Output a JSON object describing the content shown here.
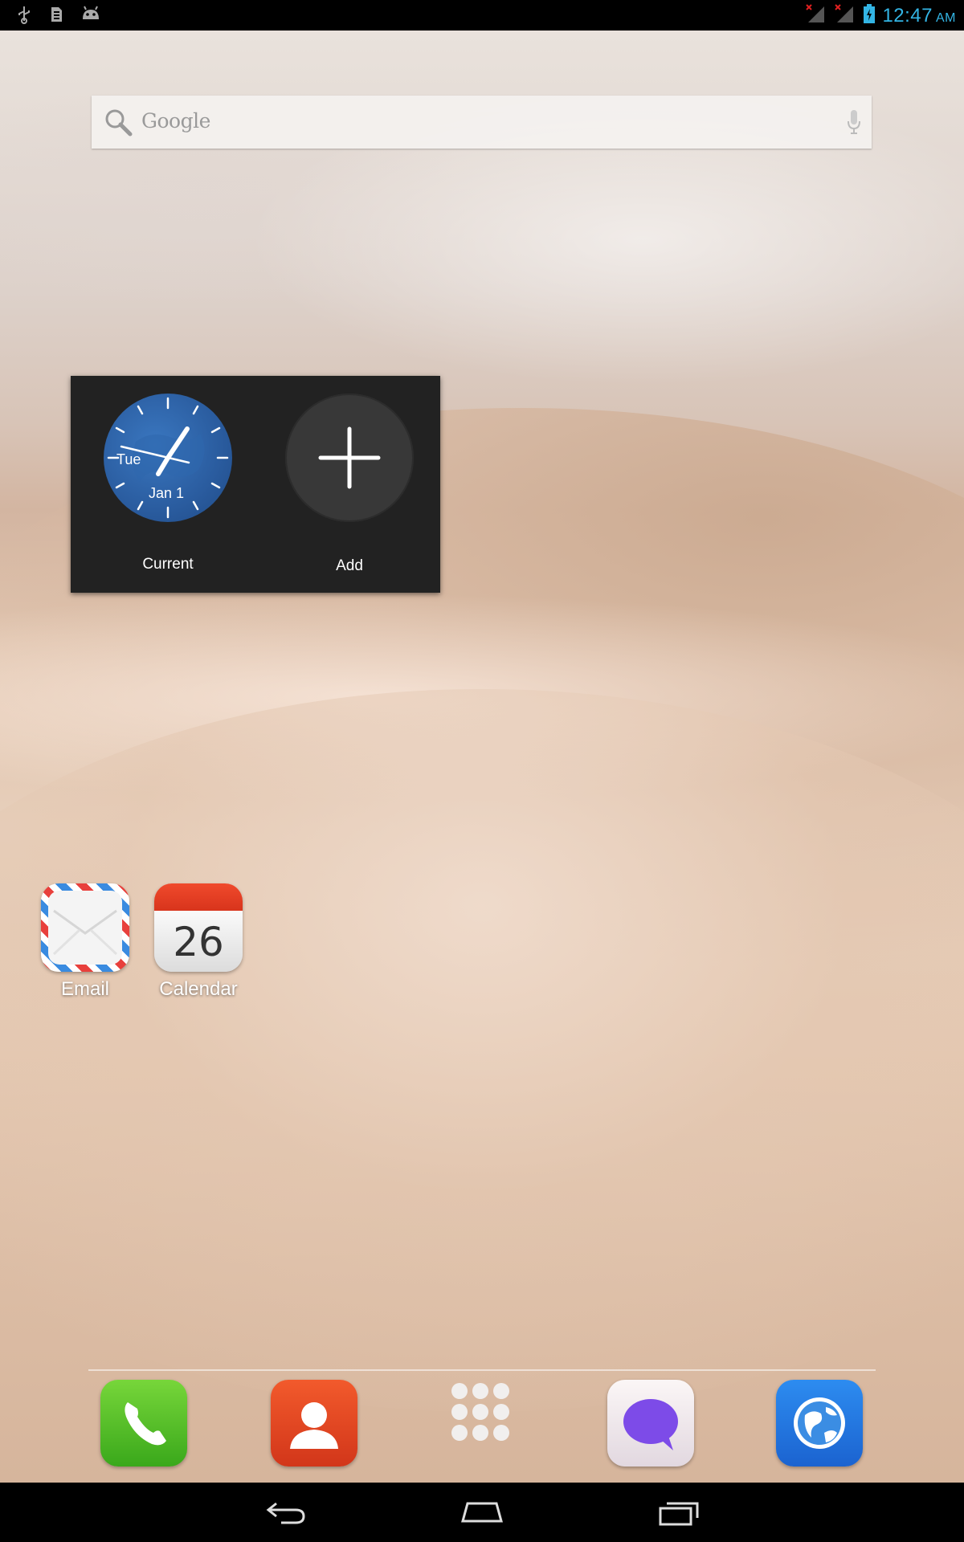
{
  "status_bar": {
    "time": "12:47",
    "ampm": "AM",
    "left_icons": [
      "usb-icon",
      "sd-card-icon",
      "android-debug-icon"
    ],
    "right_icons": [
      "signal-no-sim-1-icon",
      "signal-no-sim-2-icon",
      "battery-charging-icon"
    ],
    "accent_color": "#33b5e5"
  },
  "search": {
    "placeholder": "Google"
  },
  "clock_popup": {
    "items": [
      {
        "label": "Current",
        "day": "Tue",
        "date": "Jan 1"
      },
      {
        "label": "Add"
      }
    ]
  },
  "home_apps": [
    {
      "label": "Email",
      "icon": "email-icon"
    },
    {
      "label": "Calendar",
      "icon": "calendar-icon",
      "day_number": "26"
    }
  ],
  "dock": [
    {
      "icon": "phone-icon"
    },
    {
      "icon": "contacts-icon"
    },
    {
      "icon": "app-drawer-icon"
    },
    {
      "icon": "messaging-icon"
    },
    {
      "icon": "browser-icon"
    }
  ],
  "nav": [
    "back-icon",
    "home-icon",
    "recents-icon"
  ]
}
